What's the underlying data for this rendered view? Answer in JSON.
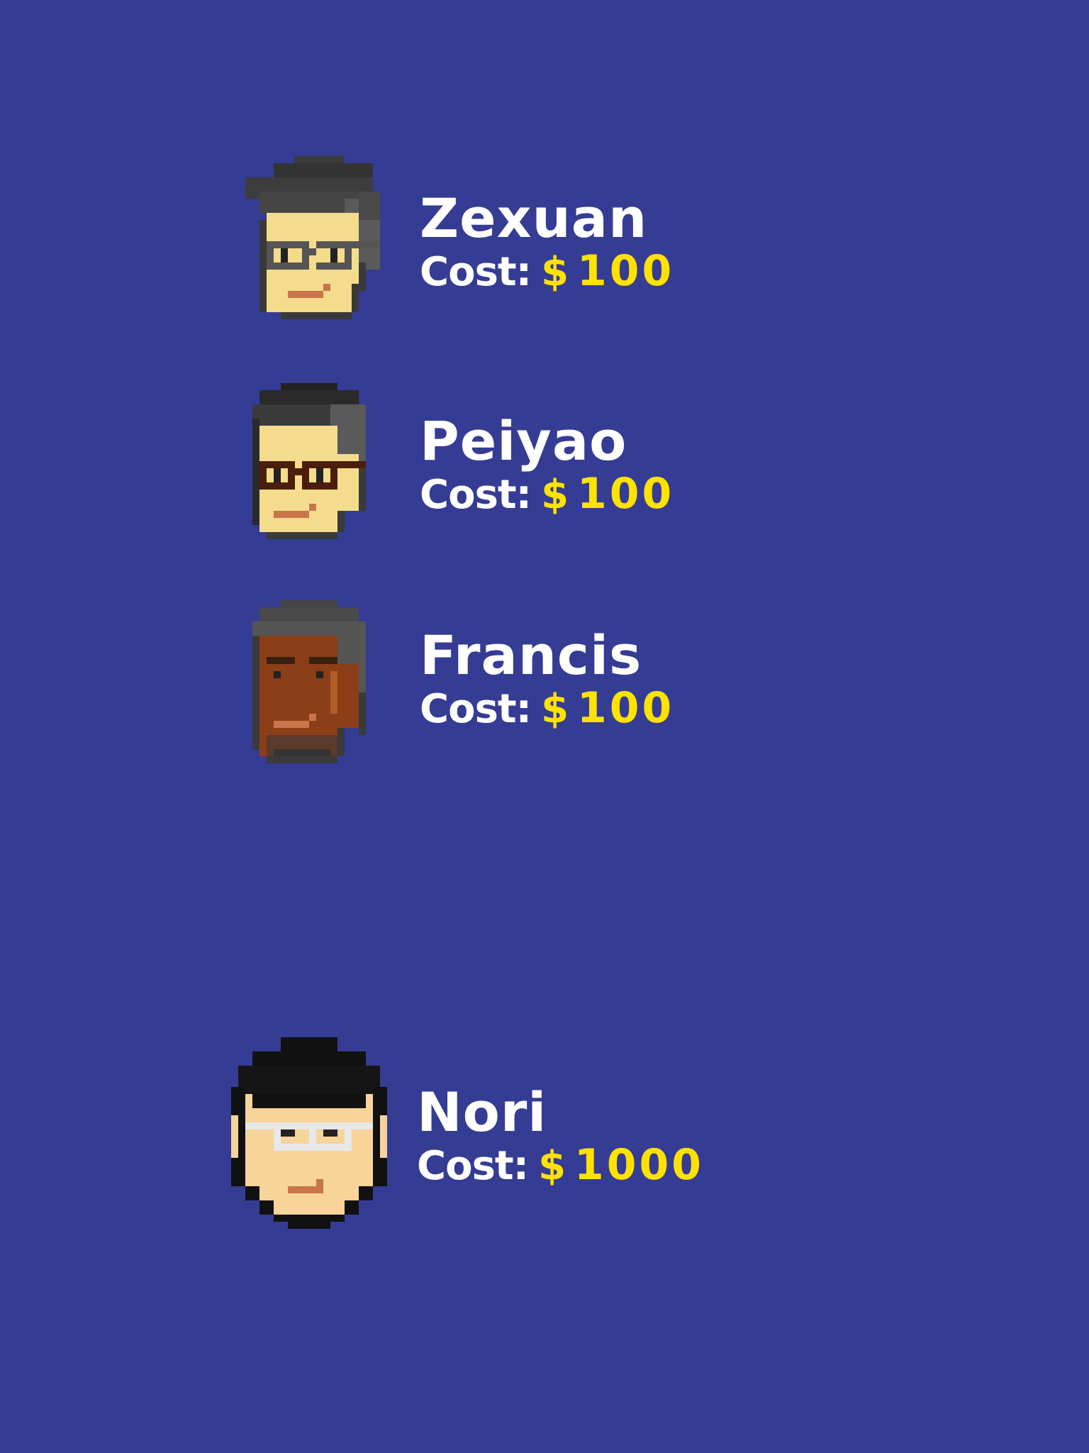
{
  "screen": {
    "background": "#353c94"
  },
  "currency_symbol": "$",
  "cost_label": "Cost:",
  "accent_color": "#ffe200",
  "characters": [
    {
      "name": "Zexuan",
      "cost": "100",
      "avatar": "zexuan-portrait"
    },
    {
      "name": "Peiyao",
      "cost": "100",
      "avatar": "peiyao-portrait"
    },
    {
      "name": "Francis",
      "cost": "100",
      "avatar": "francis-portrait"
    },
    {
      "name": "Nori",
      "cost": "1000",
      "avatar": "nori-portrait"
    }
  ]
}
